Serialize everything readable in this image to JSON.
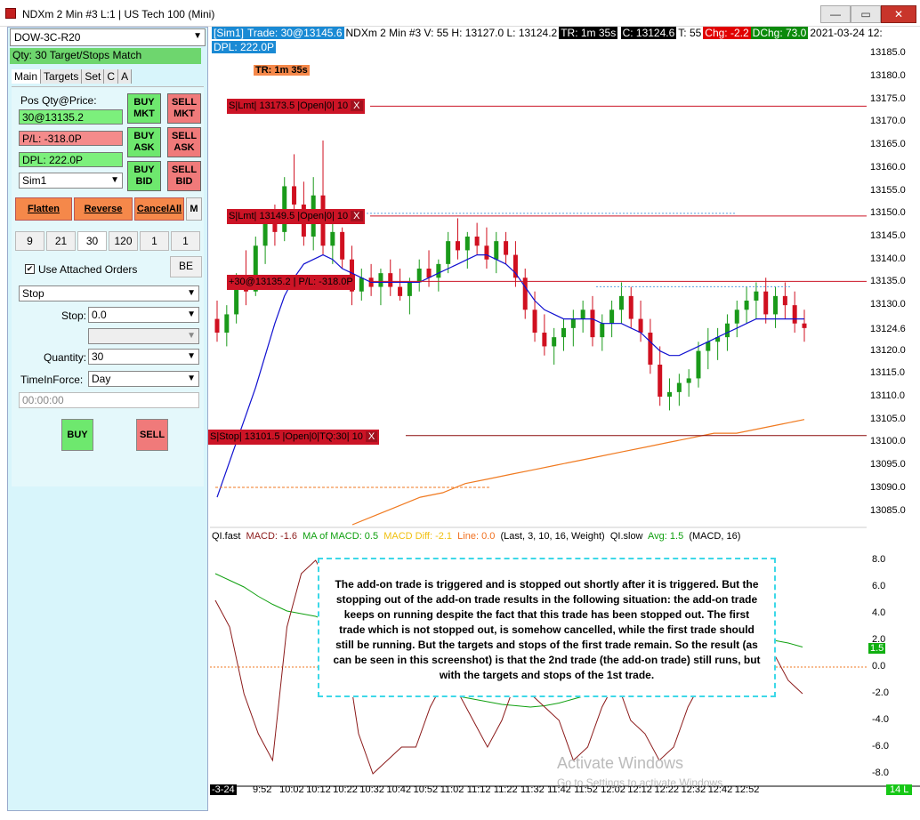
{
  "window": {
    "title": "NDXm  2 Min   #3 L:1 | US Tech 100 (Mini)",
    "minimize": "—",
    "maximize": "▭",
    "close": "✕"
  },
  "left": {
    "strategy": "DOW-3C-R20",
    "qty_status": "Qty: 30 Target/Stops Match",
    "tabs": [
      "Main",
      "Targets",
      "Set",
      "C",
      "A"
    ],
    "pos_label": "Pos Qty@Price:",
    "pos_value": "30@13135.2",
    "pl_value": "P/L: -318.0P",
    "dpl_value": "DPL: 222.0P",
    "account": "Sim1",
    "buy_mkt": "BUY MKT",
    "sell_mkt": "SELL MKT",
    "buy_ask": "BUY ASK",
    "sell_ask": "SELL ASK",
    "buy_bid": "BUY BID",
    "sell_bid": "SELL BID",
    "flatten": "Flatten",
    "reverse": "Reverse",
    "cancel_all": "CancelAll",
    "m": "M",
    "quick_qty": [
      "9",
      "21",
      "30",
      "120",
      "1",
      "1"
    ],
    "use_attached": "Use Attached Orders",
    "be": "BE",
    "order_type": "Stop",
    "stop_label": "Stop:",
    "stop_value": "0.0",
    "quantity_label": "Quantity:",
    "quantity_value": "30",
    "tif_label": "TimeInForce:",
    "tif_value": "Day",
    "time_placeholder": "00:00:00",
    "buy": "BUY",
    "sell": "SELL"
  },
  "chart": {
    "header": {
      "sim": "[Sim1]",
      "trade": "Trade: 30@13145.6",
      "symbol": "NDXm  2 Min  #3 V: 55 H: 13127.0 L: 13124.2",
      "tr": "TR: 1m 35s",
      "c": "C: 13124.6",
      "t": "T: 55",
      "chg": "Chg: -2.2",
      "dchg": "DChg: 73.0",
      "date": "2021-03-24 12:",
      "dpl": "DPL: 222.0P"
    },
    "tr_badge": "TR: 1m 35s",
    "orders": [
      {
        "text": "S|Lmt| 13173.5 |Open|0| 10",
        "x": "X"
      },
      {
        "text": "S|Lmt| 13149.5 |Open|0| 10",
        "x": "X"
      },
      {
        "text": "+30@13135.2 | P/L: -318.0P",
        "x": ""
      },
      {
        "text": "S|Stop| 13101.5 |Open|0|TQ:30| 10",
        "x": "X"
      }
    ],
    "price_axis": [
      "13185.0",
      "13180.0",
      "13175.0",
      "13170.0",
      "13165.0",
      "13160.0",
      "13155.0",
      "13150.0",
      "13145.0",
      "13140.0",
      "13135.0",
      "13130.0",
      "13124.6",
      "13120.0",
      "13115.0",
      "13110.0",
      "13105.0",
      "13100.0",
      "13095.0",
      "13090.0",
      "13085.0"
    ],
    "indicator_header": [
      {
        "text": "QI.fast",
        "color": "#000000"
      },
      {
        "text": "MACD: -1.6",
        "color": "#8b1a1a"
      },
      {
        "text": "MA of MACD: 0.5",
        "color": "#10a010"
      },
      {
        "text": "MACD Diff: -2.1",
        "color": "#f0c010"
      },
      {
        "text": "Line: 0.0",
        "color": "#f07020"
      },
      {
        "text": "(Last, 3, 10, 16, Weight)",
        "color": "#000000"
      },
      {
        "text": "QI.slow",
        "color": "#000000"
      },
      {
        "text": "Avg: 1.5",
        "color": "#10a010"
      },
      {
        "text": "(MACD, 16)",
        "color": "#000000"
      }
    ],
    "ind_axis": [
      "8.0",
      "6.0",
      "4.0",
      "2.0",
      "0.0",
      "-2.0",
      "-4.0",
      "-6.0",
      "-8.0"
    ],
    "ind_last": "1.5",
    "time_axis": [
      "-3-24",
      "9:52",
      "10:02",
      "10:12",
      "10:22",
      "10:32",
      "10:42",
      "10:52",
      "11:02",
      "11:12",
      "11:22",
      "11:32",
      "11:42",
      "11:52",
      "12:02",
      "12:12",
      "12:22",
      "12:32",
      "12:42",
      "12:52"
    ],
    "last_badge": "14 L",
    "note": "The add-on trade is triggered and is stopped out shortly after it is triggered. But the stopping out of the add-on trade results in the following situation: the add-on trade keeps on running despite the fact that this trade has been stopped out. The first trade which is not stopped out, is somehow cancelled, while the first trade should still be running. But the targets and stops of the first trade remain. So the result (as can be seen in this screenshot) is that the 2nd trade (the add-on trade) still runs, but with the targets and stops of the 1st trade.",
    "watermark1": "Activate Windows",
    "watermark2": "Go to Settings to activate Windows."
  },
  "chart_data": {
    "type": "candlestick",
    "ylim": [
      13082,
      13187
    ],
    "candles": [
      [
        13127,
        13131,
        13122,
        13124
      ],
      [
        13124,
        13130,
        13121,
        13128
      ],
      [
        13128,
        13137,
        13126,
        13135
      ],
      [
        13135,
        13142,
        13130,
        13133
      ],
      [
        13133,
        13145,
        13132,
        13143
      ],
      [
        13143,
        13150,
        13139,
        13148
      ],
      [
        13148,
        13152,
        13143,
        13146
      ],
      [
        13146,
        13158,
        13144,
        13156
      ],
      [
        13156,
        13163,
        13150,
        13152
      ],
      [
        13152,
        13157,
        13143,
        13145
      ],
      [
        13145,
        13158,
        13142,
        13154
      ],
      [
        13154,
        13166,
        13141,
        13143
      ],
      [
        13143,
        13150,
        13139,
        13146
      ],
      [
        13146,
        13147,
        13138,
        13140
      ],
      [
        13140,
        13143,
        13130,
        13133
      ],
      [
        13133,
        13138,
        13131,
        13136
      ],
      [
        13136,
        13139,
        13132,
        13134
      ],
      [
        13134,
        13138,
        13130,
        13137
      ],
      [
        13137,
        13140,
        13132,
        13134
      ],
      [
        13134,
        13138,
        13131,
        13132
      ],
      [
        13132,
        13136,
        13128,
        13135
      ],
      [
        13135,
        13140,
        13133,
        13138
      ],
      [
        13138,
        13142,
        13134,
        13136
      ],
      [
        13136,
        13140,
        13133,
        13139
      ],
      [
        13139,
        13146,
        13137,
        13144
      ],
      [
        13144,
        13149,
        13140,
        13142
      ],
      [
        13142,
        13146,
        13138,
        13145
      ],
      [
        13145,
        13148,
        13141,
        13143
      ],
      [
        13143,
        13147,
        13138,
        13140
      ],
      [
        13140,
        13146,
        13137,
        13144
      ],
      [
        13144,
        13146,
        13139,
        13141
      ],
      [
        13141,
        13144,
        13134,
        13136
      ],
      [
        13136,
        13138,
        13127,
        13129
      ],
      [
        13129,
        13133,
        13122,
        13124
      ],
      [
        13124,
        13128,
        13119,
        13121
      ],
      [
        13121,
        13125,
        13117,
        13123
      ],
      [
        13123,
        13127,
        13120,
        13125
      ],
      [
        13125,
        13129,
        13121,
        13127
      ],
      [
        13127,
        13131,
        13124,
        13129
      ],
      [
        13129,
        13132,
        13121,
        13123
      ],
      [
        13123,
        13128,
        13120,
        13126
      ],
      [
        13126,
        13131,
        13123,
        13129
      ],
      [
        13129,
        13135,
        13126,
        13132
      ],
      [
        13132,
        13134,
        13125,
        13127
      ],
      [
        13127,
        13131,
        13122,
        13124
      ],
      [
        13124,
        13127,
        13115,
        13117
      ],
      [
        13117,
        13121,
        13108,
        13110
      ],
      [
        13110,
        13114,
        13107,
        13111
      ],
      [
        13111,
        13115,
        13108,
        13113
      ],
      [
        13113,
        13116,
        13110,
        13114
      ],
      [
        13114,
        13122,
        13112,
        13120
      ],
      [
        13120,
        13125,
        13116,
        13122
      ],
      [
        13122,
        13125,
        13118,
        13123
      ],
      [
        13123,
        13128,
        13120,
        13126
      ],
      [
        13126,
        13131,
        13123,
        13129
      ],
      [
        13129,
        13134,
        13126,
        13131
      ],
      [
        13131,
        13135,
        13127,
        13133
      ],
      [
        13133,
        13136,
        13126,
        13128
      ],
      [
        13128,
        13134,
        13125,
        13132
      ],
      [
        13132,
        13135,
        13127,
        13130
      ],
      [
        13130,
        13133,
        13124,
        13126
      ],
      [
        13126,
        13129,
        13122,
        13125
      ]
    ],
    "ma_fast": [
      13088,
      13094,
      13100,
      13106,
      13112,
      13119,
      13126,
      13132,
      13136,
      13139,
      13140,
      13141,
      13140,
      13138,
      13137,
      13136,
      13135,
      13135,
      13135,
      13135,
      13135,
      13135,
      13136,
      13137,
      13138,
      13139,
      13140,
      13141,
      13141,
      13140,
      13139,
      13137,
      13134,
      13131,
      13129,
      13128,
      13127,
      13127,
      13127,
      13127,
      13126,
      13126,
      13126,
      13125,
      13124,
      13122,
      13120,
      13119,
      13119,
      13120,
      13121,
      13122,
      13123,
      13124,
      13125,
      13126,
      13127,
      13127,
      13127,
      13127,
      13127,
      13127
    ],
    "ma_slow_line": [
      13082,
      13084,
      13086,
      13088,
      13089,
      13091,
      13092,
      13093,
      13094,
      13095,
      13096,
      13097,
      13098,
      13099,
      13100,
      13101,
      13102,
      13102,
      13103,
      13104,
      13105
    ],
    "lines": {
      "target1": 13173.5,
      "target2": 13149.5,
      "entry": 13135.2,
      "stop": 13101.5
    }
  }
}
